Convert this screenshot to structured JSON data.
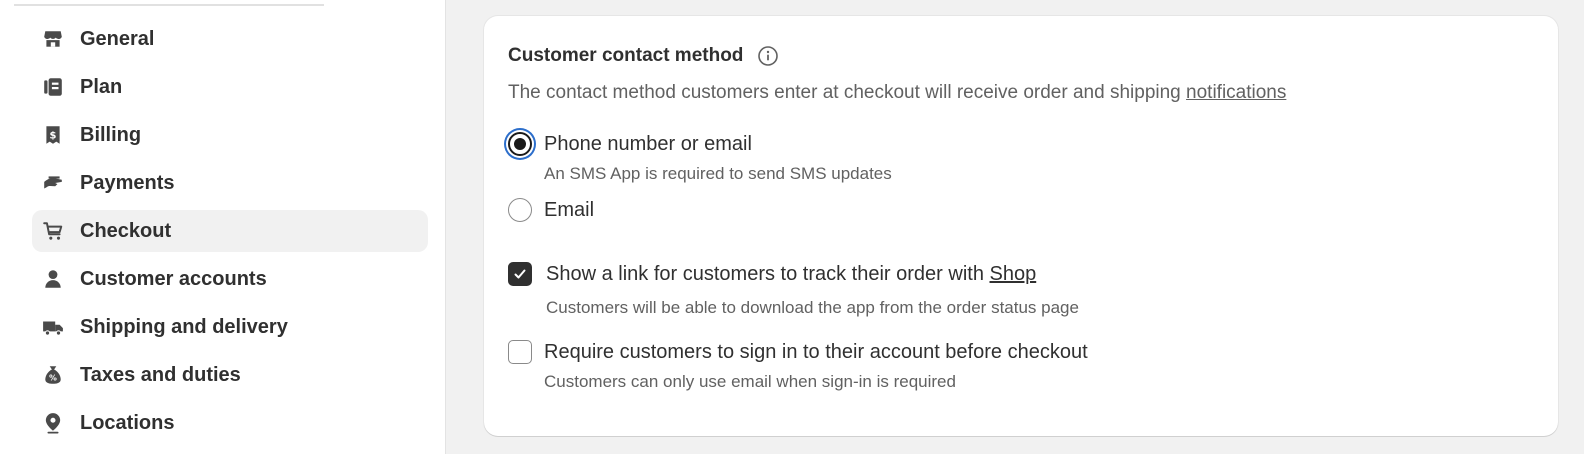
{
  "sidebar": {
    "items": [
      {
        "label": "General",
        "icon": "store-icon"
      },
      {
        "label": "Plan",
        "icon": "plan-icon"
      },
      {
        "label": "Billing",
        "icon": "receipt-icon"
      },
      {
        "label": "Payments",
        "icon": "hand-cash-icon"
      },
      {
        "label": "Checkout",
        "icon": "cart-icon",
        "active": true
      },
      {
        "label": "Customer accounts",
        "icon": "person-icon"
      },
      {
        "label": "Shipping and delivery",
        "icon": "truck-icon"
      },
      {
        "label": "Taxes and duties",
        "icon": "tax-bag-icon"
      },
      {
        "label": "Locations",
        "icon": "location-pin-icon"
      }
    ]
  },
  "card": {
    "title": "Customer contact method",
    "description": "The contact method customers enter at checkout will receive order and shipping ",
    "description_link": "notifications",
    "radios": [
      {
        "label": "Phone number or email",
        "help": "An SMS App is required to send SMS updates",
        "checked": true
      },
      {
        "label": "Email",
        "help": "",
        "checked": false
      }
    ],
    "checkboxes": [
      {
        "label": "Show a link for customers to track their order with ",
        "link": "Shop",
        "help": "Customers will be able to download the app from the order status page",
        "checked": true
      },
      {
        "label": "Require customers to sign in to their account before checkout",
        "link": "",
        "help": "Customers can only use email when sign-in is required",
        "checked": false
      }
    ]
  },
  "colors": {
    "text": "#303030",
    "subdued": "#616161",
    "focus_ring": "#2c6ecb",
    "active_nav_bg": "#f1f1f1"
  }
}
